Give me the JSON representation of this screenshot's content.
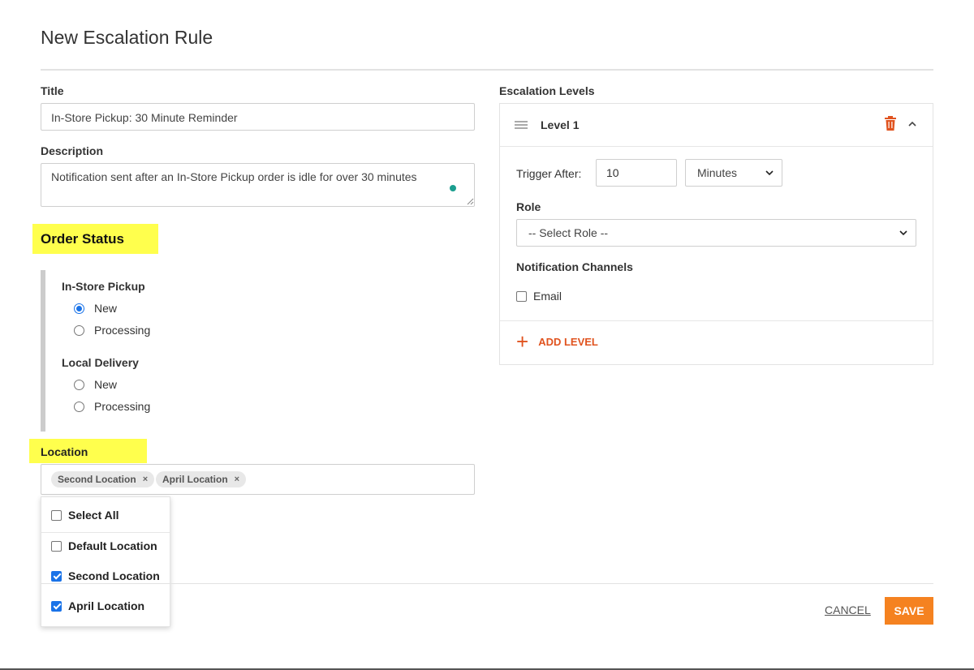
{
  "dialog": {
    "title": "New Escalation Rule"
  },
  "form": {
    "title_label": "Title",
    "title_value": "In-Store Pickup: 30 Minute Reminder",
    "description_label": "Description",
    "description_value": "Notification sent after an In-Store Pickup order is idle for over 30 minutes"
  },
  "order_status": {
    "heading": "Order Status",
    "groups": [
      {
        "label": "In-Store Pickup",
        "options": [
          {
            "label": "New",
            "checked": true
          },
          {
            "label": "Processing",
            "checked": false
          }
        ]
      },
      {
        "label": "Local Delivery",
        "options": [
          {
            "label": "New",
            "checked": false
          },
          {
            "label": "Processing",
            "checked": false
          }
        ]
      }
    ]
  },
  "location": {
    "label": "Location",
    "selected_chips": [
      {
        "label": "Second Location",
        "remove": "×"
      },
      {
        "label": "April Location",
        "remove": "×"
      }
    ],
    "dropdown": {
      "select_all": {
        "label": "Select All",
        "checked": false
      },
      "options": [
        {
          "label": "Default Location",
          "checked": false
        },
        {
          "label": "Second Location",
          "checked": true
        },
        {
          "label": "April Location",
          "checked": true
        }
      ]
    }
  },
  "escalation": {
    "label": "Escalation Levels",
    "level": {
      "title": "Level 1",
      "trigger_label": "Trigger After:",
      "trigger_value": "10",
      "unit_selected": "Minutes",
      "role_label": "Role",
      "role_selected": "-- Select Role --",
      "channels_label": "Notification Channels",
      "channels": [
        {
          "label": "Email",
          "checked": false
        }
      ]
    },
    "add_level_label": "ADD LEVEL"
  },
  "footer": {
    "cancel_label": "CANCEL",
    "save_label": "SAVE"
  },
  "colors": {
    "accent": "#f58220",
    "add_level": "#e0531f",
    "highlight": "#ffff4d",
    "checkbox_checked": "#1a73e8",
    "trash": "#e0531f"
  }
}
